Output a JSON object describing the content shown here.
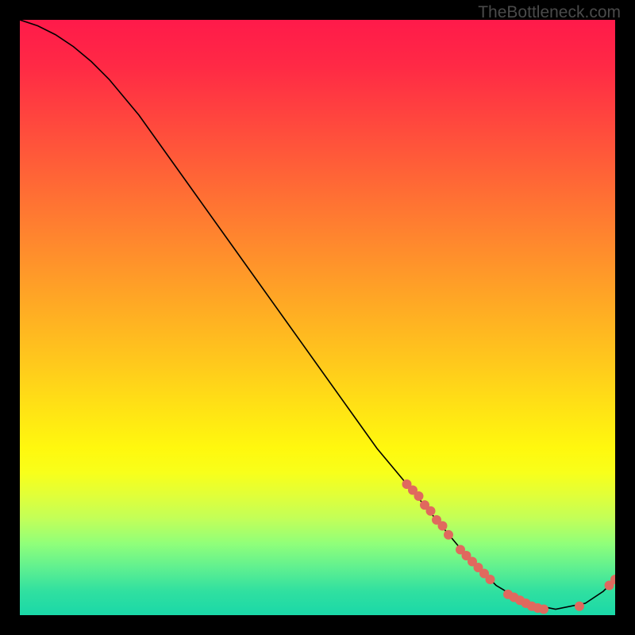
{
  "watermark": "TheBottleneck.com",
  "chart_data": {
    "type": "line",
    "title": "",
    "xlabel": "",
    "ylabel": "",
    "xlim": [
      0,
      100
    ],
    "ylim": [
      0,
      100
    ],
    "curve": [
      {
        "x": 0,
        "y": 100
      },
      {
        "x": 3,
        "y": 99
      },
      {
        "x": 6,
        "y": 97.5
      },
      {
        "x": 9,
        "y": 95.5
      },
      {
        "x": 12,
        "y": 93
      },
      {
        "x": 15,
        "y": 90
      },
      {
        "x": 20,
        "y": 84
      },
      {
        "x": 25,
        "y": 77
      },
      {
        "x": 30,
        "y": 70
      },
      {
        "x": 35,
        "y": 63
      },
      {
        "x": 40,
        "y": 56
      },
      {
        "x": 45,
        "y": 49
      },
      {
        "x": 50,
        "y": 42
      },
      {
        "x": 55,
        "y": 35
      },
      {
        "x": 60,
        "y": 28
      },
      {
        "x": 65,
        "y": 22
      },
      {
        "x": 70,
        "y": 16
      },
      {
        "x": 75,
        "y": 10
      },
      {
        "x": 80,
        "y": 5
      },
      {
        "x": 85,
        "y": 2
      },
      {
        "x": 90,
        "y": 1
      },
      {
        "x": 95,
        "y": 2
      },
      {
        "x": 98,
        "y": 4
      },
      {
        "x": 100,
        "y": 6
      }
    ],
    "dot_clusters": [
      {
        "x": 65,
        "y": 22
      },
      {
        "x": 66,
        "y": 21
      },
      {
        "x": 67,
        "y": 20
      },
      {
        "x": 68,
        "y": 18.5
      },
      {
        "x": 69,
        "y": 17.5
      },
      {
        "x": 70,
        "y": 16
      },
      {
        "x": 71,
        "y": 15
      },
      {
        "x": 72,
        "y": 13.5
      },
      {
        "x": 74,
        "y": 11
      },
      {
        "x": 75,
        "y": 10
      },
      {
        "x": 76,
        "y": 9
      },
      {
        "x": 77,
        "y": 8
      },
      {
        "x": 78,
        "y": 7
      },
      {
        "x": 79,
        "y": 6
      },
      {
        "x": 82,
        "y": 3.5
      },
      {
        "x": 83,
        "y": 3
      },
      {
        "x": 84,
        "y": 2.5
      },
      {
        "x": 85,
        "y": 2
      },
      {
        "x": 86,
        "y": 1.5
      },
      {
        "x": 87,
        "y": 1.2
      },
      {
        "x": 88,
        "y": 1
      },
      {
        "x": 94,
        "y": 1.5
      },
      {
        "x": 99,
        "y": 5
      },
      {
        "x": 100,
        "y": 6
      }
    ],
    "colors": {
      "curve": "#000000",
      "dots": "#e0695e"
    }
  }
}
